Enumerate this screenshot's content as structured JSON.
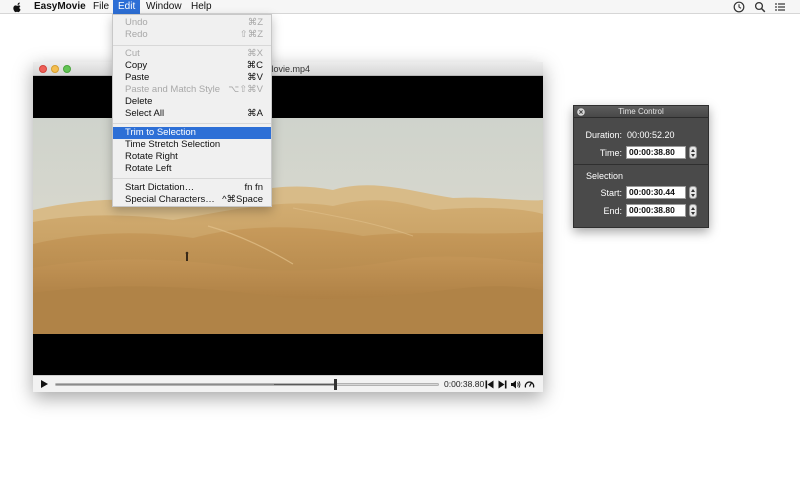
{
  "menubar": {
    "apple_icon": "apple-icon",
    "app_name": "EasyMovie",
    "menus": [
      "File",
      "Edit",
      "Window",
      "Help"
    ],
    "right_icons": [
      "clock-icon",
      "search-icon",
      "list-icon"
    ]
  },
  "edit_menu": {
    "items": [
      {
        "label": "Undo",
        "shortcut": "⌘Z",
        "enabled": false
      },
      {
        "label": "Redo",
        "shortcut": "⇧⌘Z",
        "enabled": false
      },
      {
        "label": "Cut",
        "shortcut": "⌘X",
        "enabled": false
      },
      {
        "label": "Copy",
        "shortcut": "⌘C",
        "enabled": true
      },
      {
        "label": "Paste",
        "shortcut": "⌘V",
        "enabled": true
      },
      {
        "label": "Paste and Match Style",
        "shortcut": "⌥⇧⌘V",
        "enabled": false
      },
      {
        "label": "Delete",
        "shortcut": "",
        "enabled": true
      },
      {
        "label": "Select All",
        "shortcut": "⌘A",
        "enabled": true
      },
      {
        "label": "Trim to Selection",
        "shortcut": "",
        "enabled": true,
        "highlighted": true
      },
      {
        "label": "Time Stretch Selection",
        "shortcut": "",
        "enabled": true
      },
      {
        "label": "Rotate Right",
        "shortcut": "",
        "enabled": true
      },
      {
        "label": "Rotate Left",
        "shortcut": "",
        "enabled": true
      },
      {
        "label": "Start Dictation…",
        "shortcut": "fn fn",
        "enabled": true
      },
      {
        "label": "Special Characters…",
        "shortcut": "^⌘Space",
        "enabled": true
      }
    ]
  },
  "movie_window": {
    "title": "Movie.mp4",
    "current_time": "0:00:38.80",
    "progress": 0.73,
    "selection_start": 0.57,
    "selection_end": 0.73,
    "control_icons": [
      "play-icon",
      "previous-icon",
      "next-icon",
      "volume-icon",
      "speed-icon"
    ]
  },
  "time_control": {
    "title": "Time Control",
    "duration_label": "Duration:",
    "duration_value": "00:00:52.20",
    "time_label": "Time:",
    "time_value": "00:00:38.80",
    "selection_heading": "Selection",
    "start_label": "Start:",
    "start_value": "00:00:30.44",
    "end_label": "End:",
    "end_value": "00:00:38.80"
  },
  "colors": {
    "accent": "#2d6fd6",
    "panel_bg": "#4a4a4a",
    "sand": "#c9a05f",
    "sky": "#d9dcd5"
  }
}
